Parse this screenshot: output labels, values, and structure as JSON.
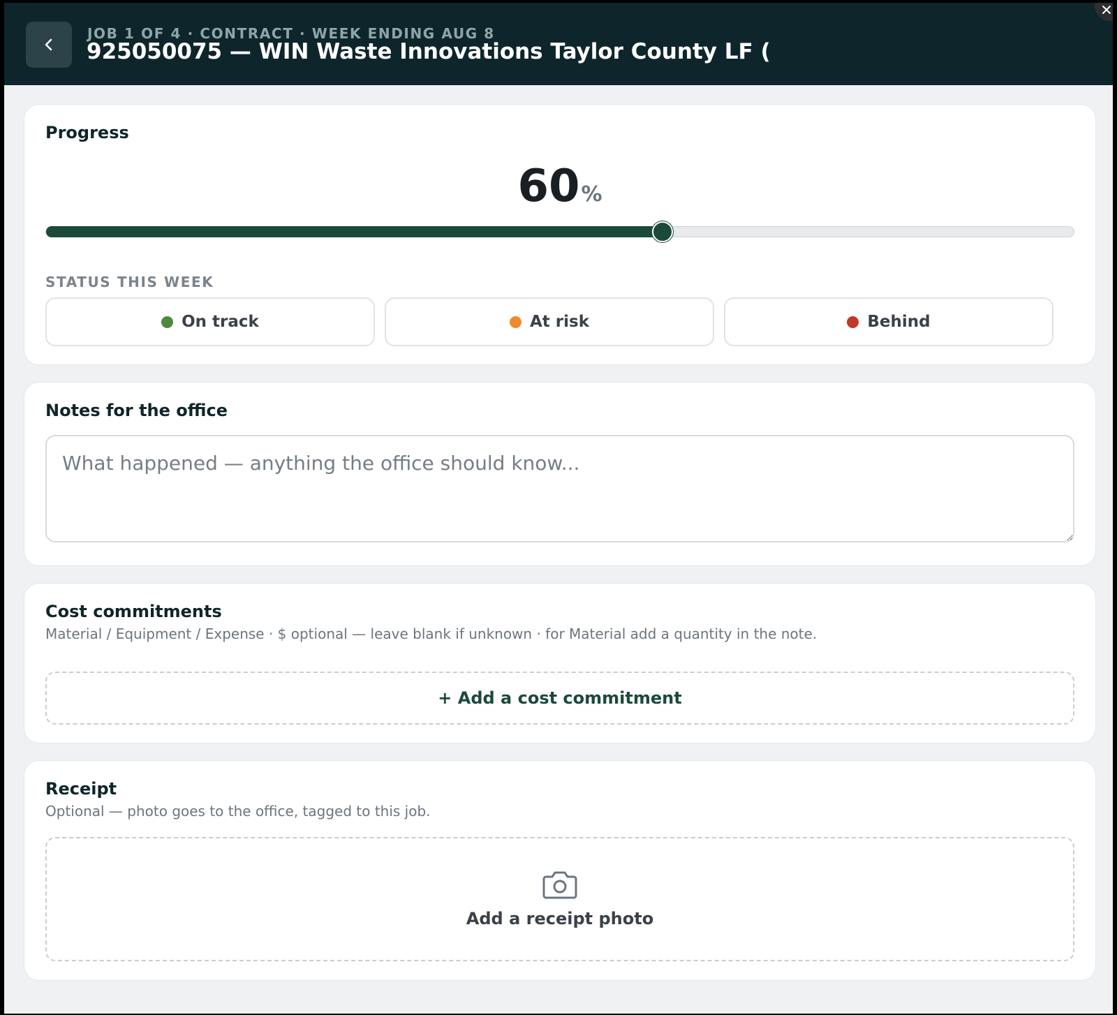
{
  "header": {
    "back_icon": "chevron-left-icon",
    "breadcrumb": "JOB 1 OF 4 · CONTRACT · WEEK ENDING AUG 8",
    "title": "925050075 — WIN Waste Innovations Taylor County LF (",
    "close_icon": "close-icon"
  },
  "progress": {
    "title": "Progress",
    "value": "60",
    "unit": "%",
    "slider_fraction": 0.6,
    "status_label": "STATUS THIS WEEK",
    "status_options": [
      {
        "label": "On track",
        "color": "#4c8a3c"
      },
      {
        "label": "At risk",
        "color": "#ee8a2a"
      },
      {
        "label": "Behind",
        "color": "#c0392b"
      }
    ]
  },
  "notes": {
    "title": "Notes for the office",
    "value": "",
    "placeholder": "What happened — anything the office should know..."
  },
  "cost": {
    "title": "Cost commitments",
    "subtitle": "Material / Equipment / Expense · $ optional — leave blank if unknown · for Material add a quantity in the note.",
    "add_label": "+ Add a cost commitment"
  },
  "receipt": {
    "title": "Receipt",
    "subtitle": "Optional — photo goes to the office, tagged to this job.",
    "icon": "camera-icon",
    "add_label": "Add a receipt photo"
  },
  "colors": {
    "header_bg": "#0e262b",
    "accent": "#1c4a3a",
    "page_bg": "#eff1f3"
  }
}
